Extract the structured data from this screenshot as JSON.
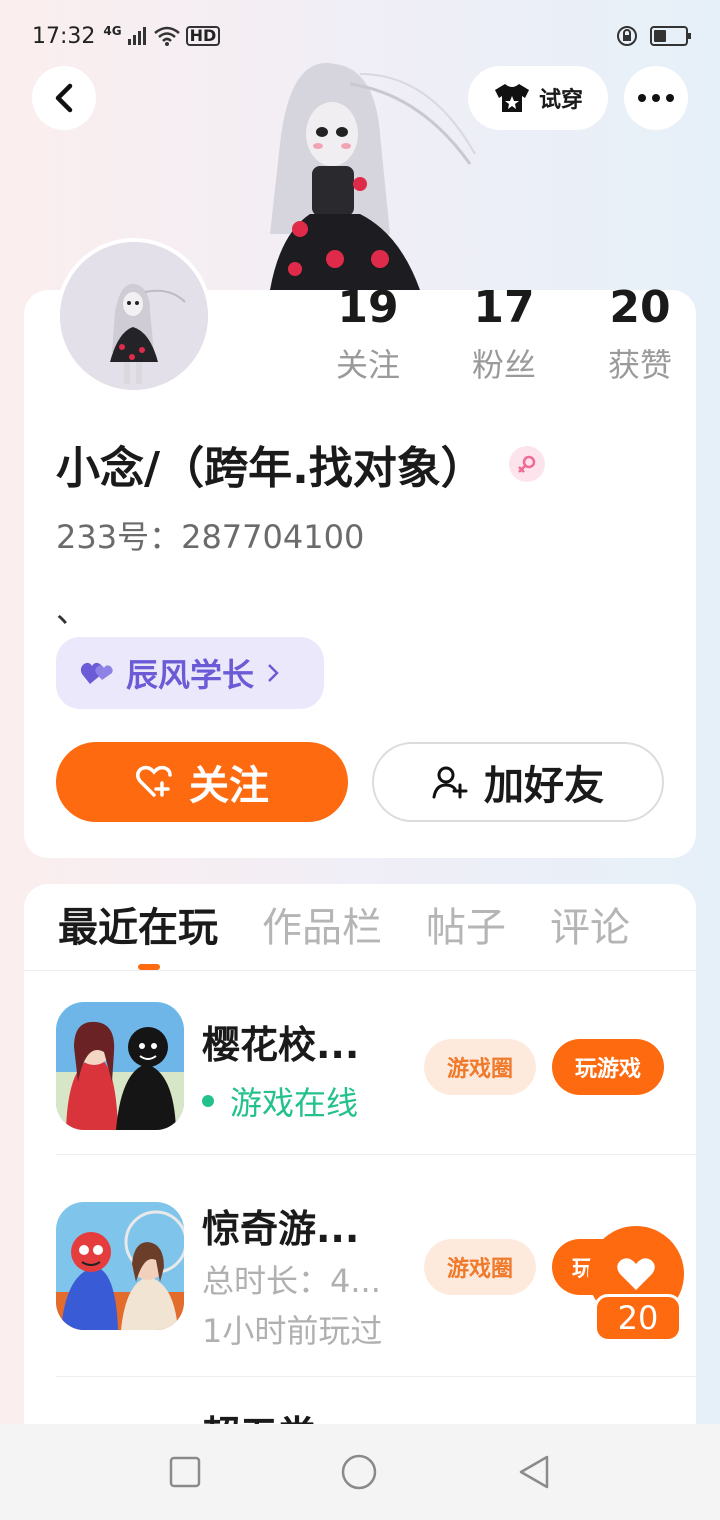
{
  "status_bar": {
    "time": "17:32",
    "network": "4G",
    "hd": "HD"
  },
  "header": {
    "try_on_label": "试穿"
  },
  "profile": {
    "stats": [
      {
        "value": "19",
        "label": "关注"
      },
      {
        "value": "17",
        "label": "粉丝"
      },
      {
        "value": "20",
        "label": "获赞"
      }
    ],
    "name": "小念/（跨年.找对象）",
    "gender_icon": "female-icon",
    "uid": "233号：287704100",
    "bio": "、",
    "relation_tag": "辰风学长",
    "follow_label": "关注",
    "add_friend_label": "加好友"
  },
  "tabs": [
    {
      "label": "最近在玩",
      "active": true
    },
    {
      "label": "作品栏",
      "active": false
    },
    {
      "label": "帖子",
      "active": false
    },
    {
      "label": "评论",
      "active": false
    }
  ],
  "games": [
    {
      "title": "樱花校...",
      "status": "游戏在线",
      "circle_label": "游戏圈",
      "play_label": "玩游戏"
    },
    {
      "title": "惊奇游...",
      "duration": "总时长：4...",
      "last_played": "1小时前玩过",
      "circle_label": "游戏圈",
      "play_label": "玩"
    },
    {
      "title": "超五尝"
    }
  ],
  "like_float": {
    "count": "20"
  },
  "colors": {
    "accent": "#fd6a0f",
    "online": "#24c18b",
    "relation": "#6b5bd6"
  }
}
